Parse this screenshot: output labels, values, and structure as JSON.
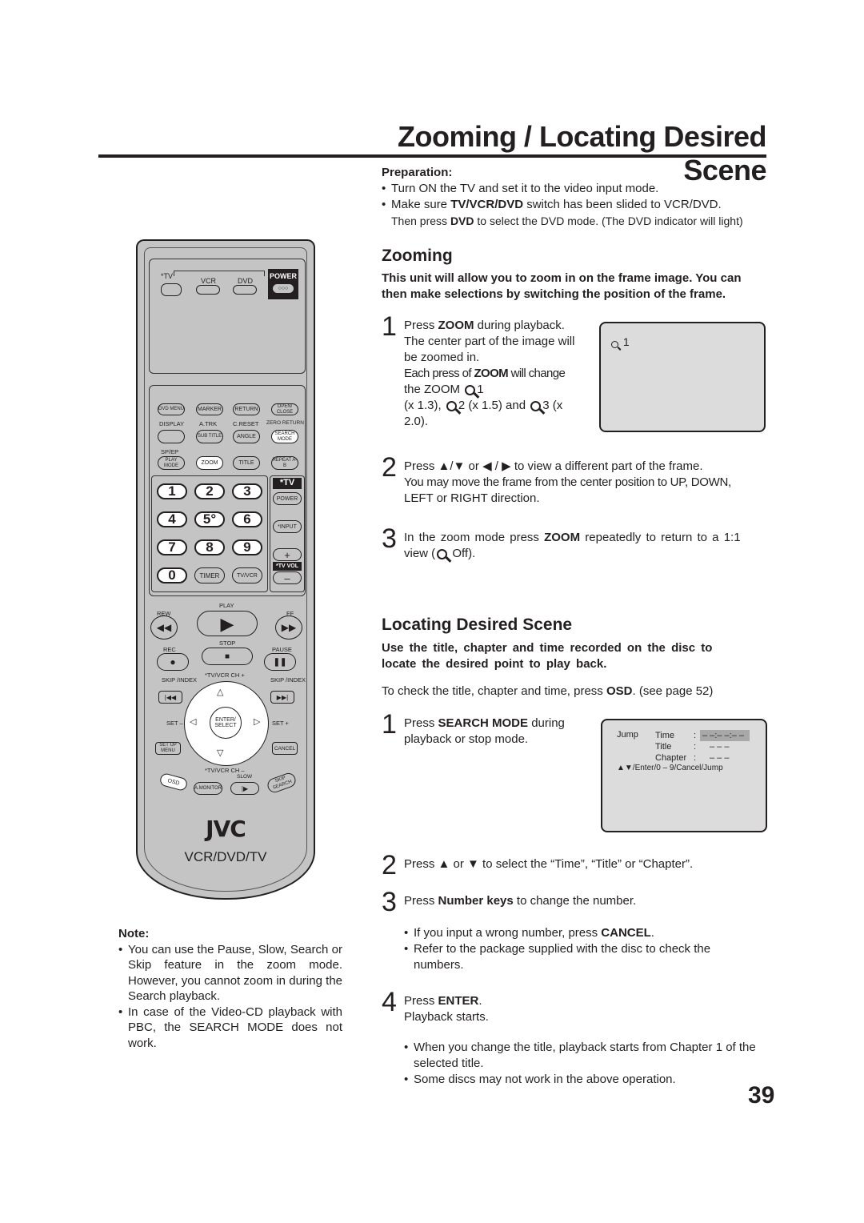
{
  "page": {
    "title": "Zooming / Locating Desired Scene",
    "page_number": "39"
  },
  "preparation": {
    "heading": "Preparation:",
    "bullet1": "Turn ON the TV and set it to the video input mode.",
    "bullet2_pre": "Make sure ",
    "bullet2_bold": "TV/VCR/DVD",
    "bullet2_post": " switch has been slided to VCR/DVD.",
    "bullet2_line2_pre": "Then press ",
    "bullet2_line2_bold": "DVD",
    "bullet2_line2_post": " to select the DVD mode. (The DVD indicator will light)"
  },
  "zooming": {
    "heading": "Zooming",
    "lead": "This unit will allow you to zoom in on the frame image. You can then make selections by switching the position of the frame.",
    "step1": {
      "num": "1",
      "l1_pre": "Press ",
      "l1_bold": "ZOOM",
      "l1_post": " during playback.",
      "l2": "The center part of the image will",
      "l3": "be zoomed in.",
      "l4_pre": "Each press of ",
      "l4_bold": "ZOOM",
      "l4_post": " will change",
      "l5_pre": "the ZOOM",
      "l5_post": "1",
      "l6_a": "(x 1.3),",
      "l6_b": "2 (x 1.5) and",
      "l6_c": "3 (x",
      "l7": "2.0).",
      "screen_label": "1"
    },
    "step2": {
      "num": "2",
      "l1_pre": "Press ",
      "l1_sym1": "▲/▼",
      "l1_mid": " or ",
      "l1_sym2": "◀ / ▶",
      "l1_post": " to view a different part of the frame.",
      "l2": "You may move the frame from the center position to UP, DOWN,",
      "l3": "LEFT or RIGHT direction."
    },
    "step3": {
      "num": "3",
      "l1_pre": "In the zoom mode press ",
      "l1_bold": "ZOOM",
      "l1_post": " repeatedly to return to a 1:1",
      "l2_pre": "view (",
      "l2_post": " Off)."
    }
  },
  "locating": {
    "heading": "Locating Desired Scene",
    "lead": "Use the title, chapter and time recorded on the disc to locate the desired point to play back.",
    "osd_pre": "To check the title, chapter and time, press ",
    "osd_bold": "OSD",
    "osd_post": ". (see page 52)",
    "step1": {
      "num": "1",
      "l1_pre": "Press ",
      "l1_bold": "SEARCH MODE",
      "l1_post": " during",
      "l2": "playback or stop mode."
    },
    "screen": {
      "jump": "Jump",
      "rows": [
        {
          "label": "Time",
          "sep": ":",
          "value": "– –:– –:– –"
        },
        {
          "label": "Title",
          "sep": ":",
          "value": "– – –"
        },
        {
          "label": "Chapter",
          "sep": ":",
          "value": "– – –"
        }
      ],
      "hint": "▲▼/Enter/0 – 9/Cancel/Jump"
    },
    "step2": {
      "num": "2",
      "text": "Press ▲ or ▼ to select the “Time”, “Title” or “Chapter”."
    },
    "step3": {
      "num": "3",
      "pre": "Press ",
      "bold": "Number keys",
      "post": " to change the number."
    },
    "bullets_a": {
      "b1_pre": "If you input a wrong number, press ",
      "b1_bold": "CANCEL",
      "b1_post": ".",
      "b2": "Refer to the package supplied with the disc to check the numbers."
    },
    "step4": {
      "num": "4",
      "pre": "Press ",
      "bold": "ENTER",
      "post": ".",
      "l2": "Playback starts."
    },
    "bullets_b": {
      "b1": "When you change the title, playback starts from Chapter 1 of the selected title.",
      "b2": "Some discs may not work in the above operation."
    }
  },
  "note": {
    "heading": "Note:",
    "b1": "You can use the Pause, Slow, Search or Skip feature in the zoom mode. However, you cannot zoom in during the Search playback.",
    "b2": "In case of the Video-CD playback with PBC, the SEARCH MODE does not work."
  },
  "remote": {
    "tv": "*TV",
    "vcr": "VCR",
    "dvd": "DVD",
    "power": "POWER",
    "power_dots": "○○○",
    "row1": [
      "DVD MENU",
      "MARKER",
      "RETURN",
      "OPEN/ CLOSE"
    ],
    "row2_labels": [
      "DISPLAY",
      "A.TRK",
      "C.RESET",
      "ZERO RETURN"
    ],
    "row2": [
      "",
      "SUB TITLE",
      "ANGLE",
      "SEARCH MODE"
    ],
    "row3_label": "SP/EP",
    "row3": [
      "PLAY MODE",
      "ZOOM",
      "TITLE",
      "REPEAT A-B"
    ],
    "numbers": [
      "1",
      "2",
      "3",
      "4",
      "5°",
      "6",
      "7",
      "8",
      "9",
      "0"
    ],
    "timer": "TIMER",
    "tvvcr": "TV/VCR",
    "tv_section": "*TV",
    "tv_power": "POWER",
    "tv_input": "*INPUT",
    "vol_plus": "+",
    "tv_vol": "*TV VOL",
    "vol_minus": "–",
    "play": "PLAY",
    "rew": "REW",
    "ff": "FF",
    "rec": "REC",
    "stop": "STOP",
    "pause": "PAUSE",
    "skip_left": "SKIP /INDEX",
    "skip_right": "SKIP /INDEX",
    "ch_up": "*TV/VCR CH +",
    "ch_down": "*TV/VCR CH –",
    "enter": "ENTER/ SELECT",
    "set_minus": "SET –",
    "set_plus": "SET +",
    "setup": "SET UP MENU",
    "cancel": "CANCEL",
    "osd": "OSD",
    "amonitor": "A.MONITOR",
    "slow": "SLOW",
    "skip_search": "SKIP SEARCH",
    "brand": "JVC",
    "model": "VCR/DVD/TV"
  }
}
